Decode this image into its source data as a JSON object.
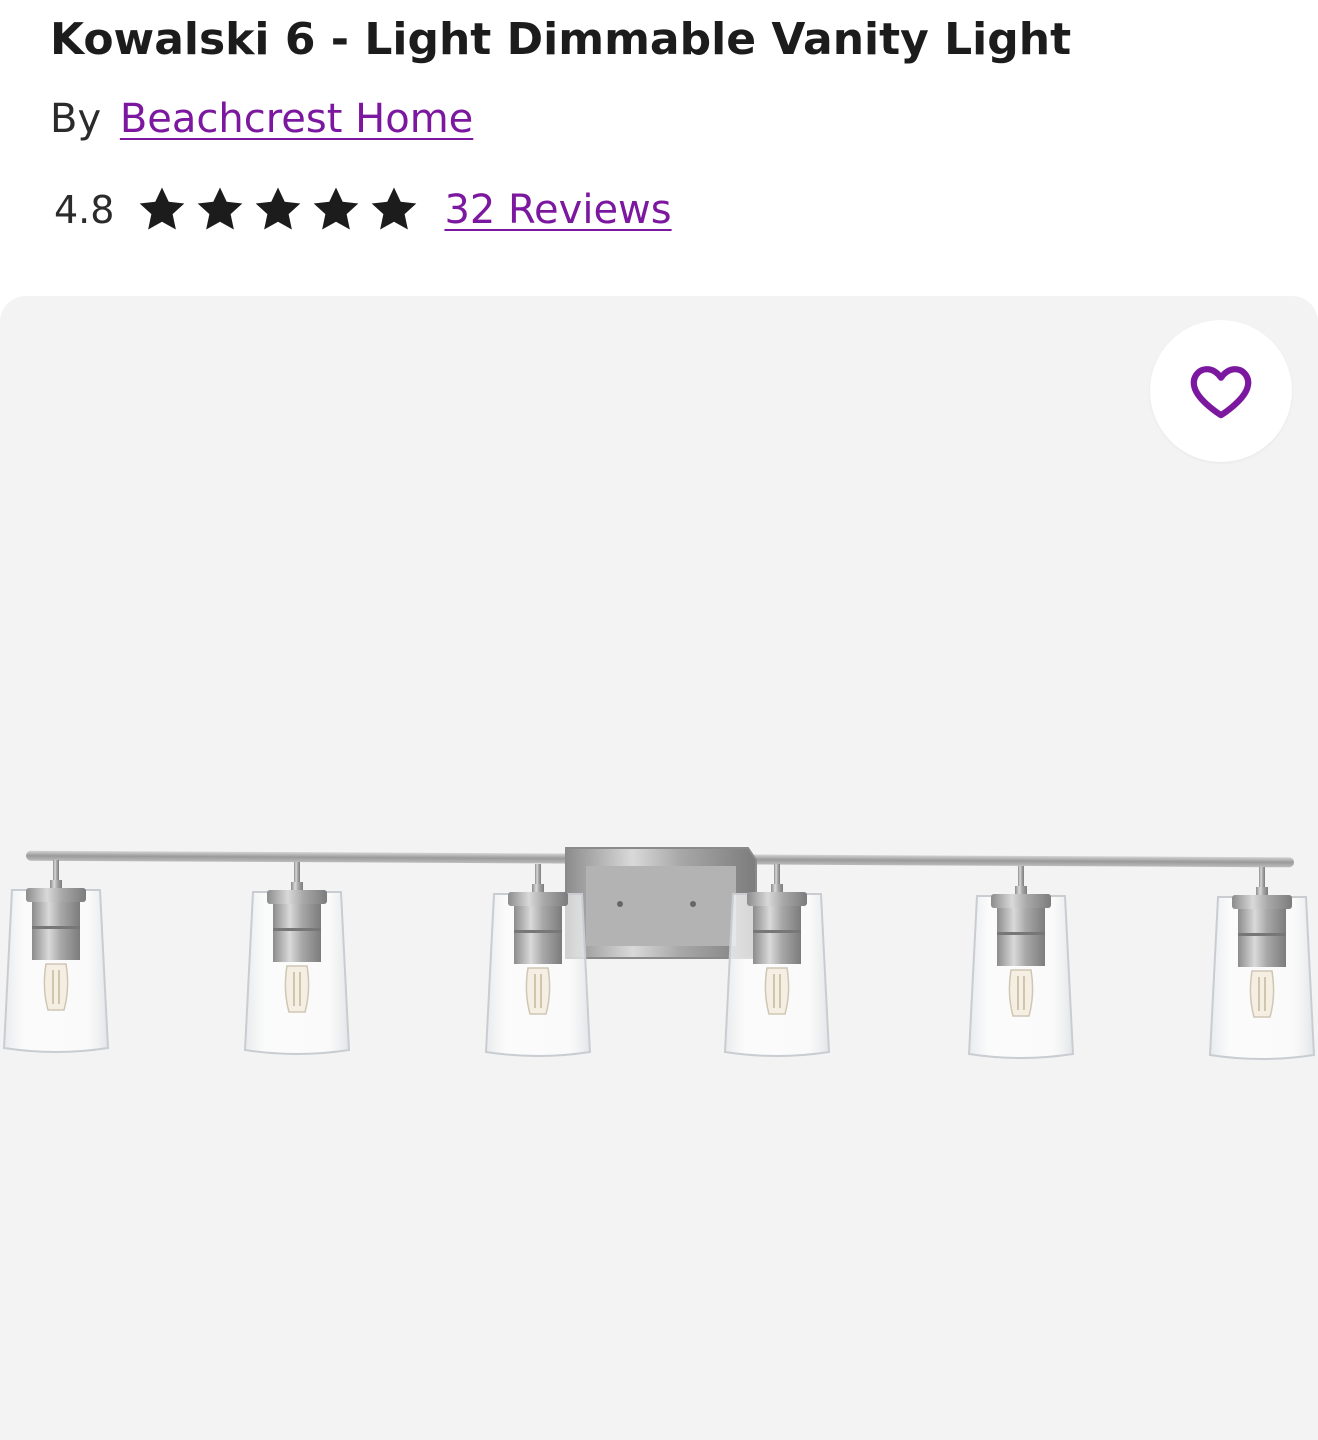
{
  "product": {
    "title": "Kowalski 6 - Light Dimmable Vanity Light",
    "by_prefix": "By",
    "brand": "Beachcrest Home",
    "rating": "4.8",
    "rating_value": 4.8,
    "rating_max": 5,
    "reviews_link": "32 Reviews"
  },
  "gallery": {
    "favorite_icon": "heart-outline-icon",
    "image_subject": "six-light brushed nickel vanity fixture"
  },
  "colors": {
    "link": "#7b189f",
    "heart": "#7b189f",
    "star": "#1c1c1c",
    "gallery_bg": "#f3f3f3"
  }
}
